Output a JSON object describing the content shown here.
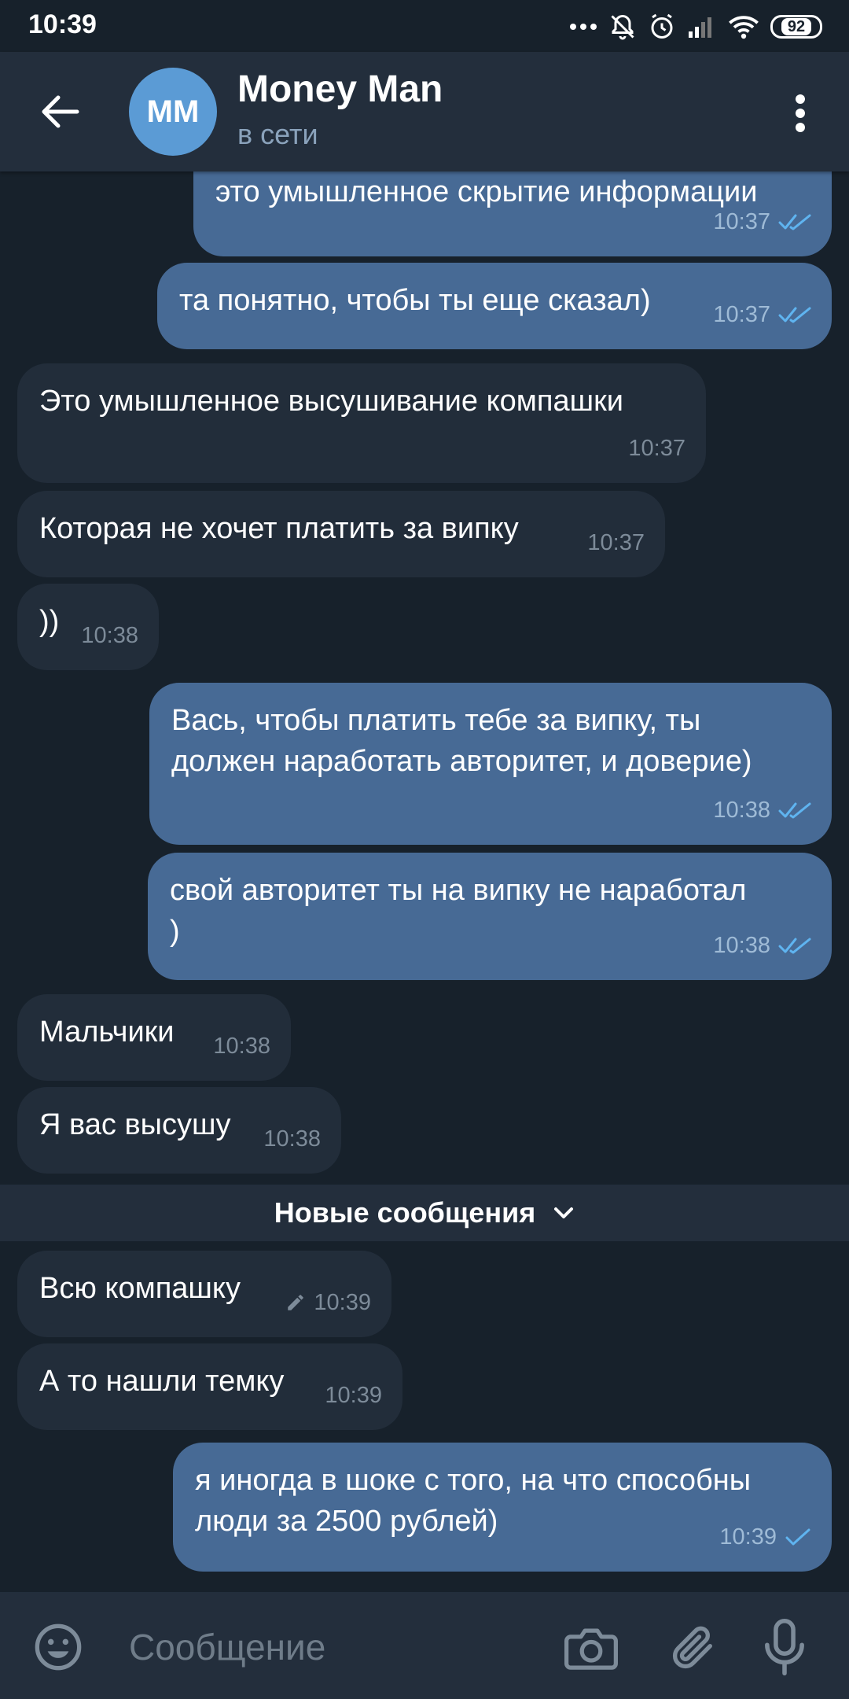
{
  "status_bar": {
    "time": "10:39",
    "battery": "92"
  },
  "chat": {
    "title": "Money Man",
    "status": "в сети",
    "avatar_initials": "MM"
  },
  "messages": [
    {
      "dir": "out",
      "text": "это умышленное скрытие информации",
      "time": "10:37",
      "state": "read"
    },
    {
      "dir": "out",
      "text": "та понятно, чтобы ты еще сказал)",
      "time": "10:37",
      "state": "read"
    },
    {
      "dir": "in",
      "text": "Это умышленное высушивание компашки",
      "time": "10:37"
    },
    {
      "dir": "in",
      "text": "Которая не хочет платить за випку",
      "time": "10:37"
    },
    {
      "dir": "in",
      "text": "))",
      "time": "10:38"
    },
    {
      "dir": "out",
      "text": "Вась, чтобы платить тебе за випку, ты\nдолжен наработать авторитет, и доверие)",
      "time": "10:38",
      "state": "read"
    },
    {
      "dir": "out",
      "text": "свой авторитет ты на випку не наработал\n)",
      "time": "10:38",
      "state": "read"
    },
    {
      "dir": "in",
      "text": "Мальчики",
      "time": "10:38"
    },
    {
      "dir": "in",
      "text": "Я вас высушу",
      "time": "10:38"
    },
    {
      "dir": "in",
      "text": "Всю компашку",
      "time": "10:39",
      "edited": true
    },
    {
      "dir": "in",
      "text": "А то нашли темку",
      "time": "10:39"
    },
    {
      "dir": "out",
      "text": "я иногда в шоке с того, на что способны\nлюди за 2500 рублей)",
      "time": "10:39",
      "state": "sent"
    }
  ],
  "new_messages_divider": "Новые сообщения",
  "input": {
    "placeholder": "Сообщение"
  },
  "icons": {
    "back": "arrow-left-icon",
    "menu": "more-vertical-icon",
    "emoji": "smiley-icon",
    "camera": "camera-icon",
    "attach": "paperclip-icon",
    "mic": "microphone-icon",
    "read": "double-check-icon",
    "sent": "single-check-icon",
    "edited": "pencil-icon"
  },
  "colors": {
    "background": "#17212b",
    "header": "#232e3c",
    "incoming": "#222d3a",
    "outgoing": "#476a95",
    "check": "#5fb4f0"
  }
}
